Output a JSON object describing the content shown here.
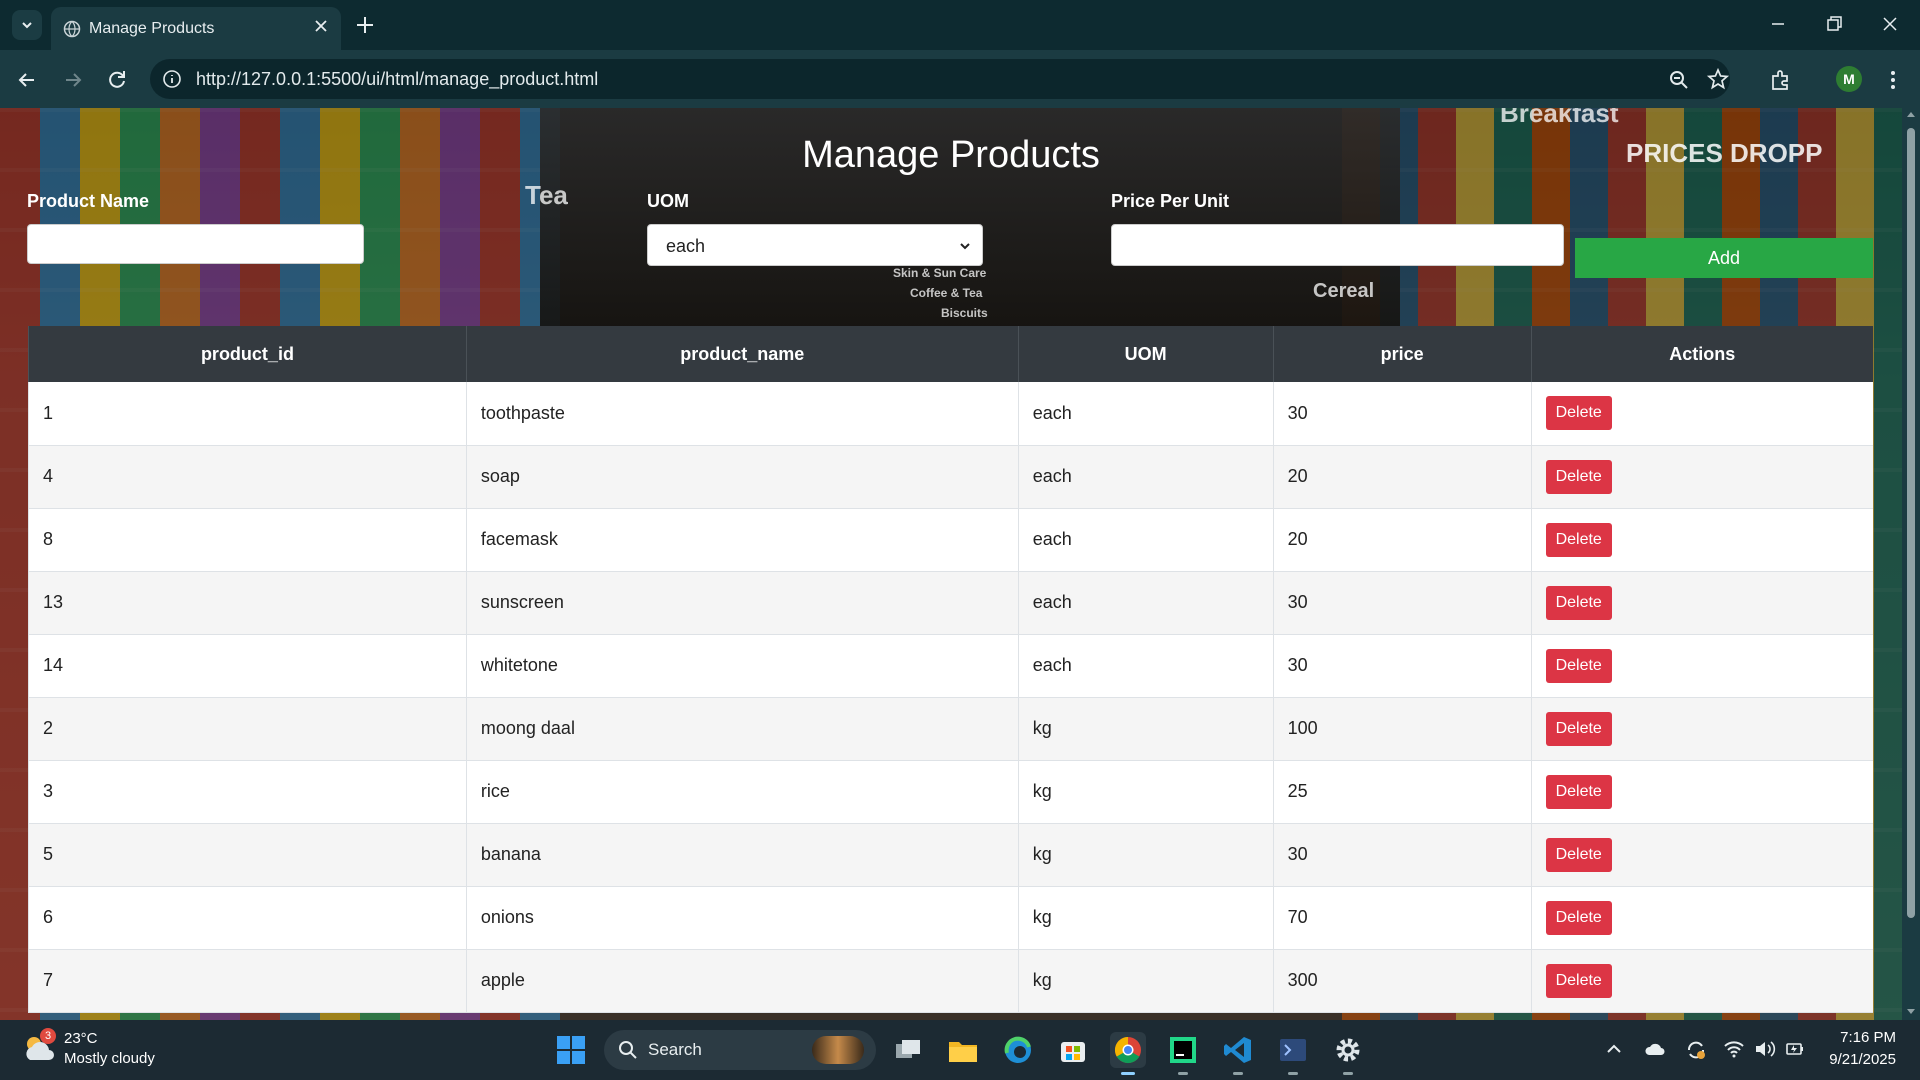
{
  "browser": {
    "tab_title": "Manage Products",
    "url": "http://127.0.0.1:5500/ui/html/manage_product.html",
    "profile_initial": "M"
  },
  "page": {
    "title": "Manage Products",
    "form": {
      "product_name_label": "Product Name",
      "uom_label": "UOM",
      "uom_selected": "each",
      "price_label": "Price Per Unit",
      "add_label": "Add"
    },
    "table": {
      "headers": [
        "product_id",
        "product_name",
        "UOM",
        "price",
        "Actions"
      ],
      "delete_label": "Delete",
      "rows": [
        {
          "id": "1",
          "name": "toothpaste",
          "uom": "each",
          "price": "30"
        },
        {
          "id": "4",
          "name": "soap",
          "uom": "each",
          "price": "20"
        },
        {
          "id": "8",
          "name": "facemask",
          "uom": "each",
          "price": "20"
        },
        {
          "id": "13",
          "name": "sunscreen",
          "uom": "each",
          "price": "30"
        },
        {
          "id": "14",
          "name": "whitetone",
          "uom": "each",
          "price": "30"
        },
        {
          "id": "2",
          "name": "moong daal",
          "uom": "kg",
          "price": "100"
        },
        {
          "id": "3",
          "name": "rice",
          "uom": "kg",
          "price": "25"
        },
        {
          "id": "5",
          "name": "banana",
          "uom": "kg",
          "price": "30"
        },
        {
          "id": "6",
          "name": "onions",
          "uom": "kg",
          "price": "70"
        },
        {
          "id": "7",
          "name": "apple",
          "uom": "kg",
          "price": "300"
        }
      ]
    },
    "background_signs": [
      "Tea",
      "Cereal",
      "PRICES DROPP",
      "Breakfast",
      "Skin & Sun Care",
      "Coffee & Tea",
      "Biscuits"
    ]
  },
  "taskbar": {
    "weather_badge": "3",
    "temperature": "23°C",
    "condition": "Mostly cloudy",
    "search_label": "Search",
    "time": "7:16 PM",
    "date": "9/21/2025"
  },
  "colors": {
    "add_button": "#28a745",
    "delete_button": "#dc3545",
    "table_header": "#343a40"
  }
}
